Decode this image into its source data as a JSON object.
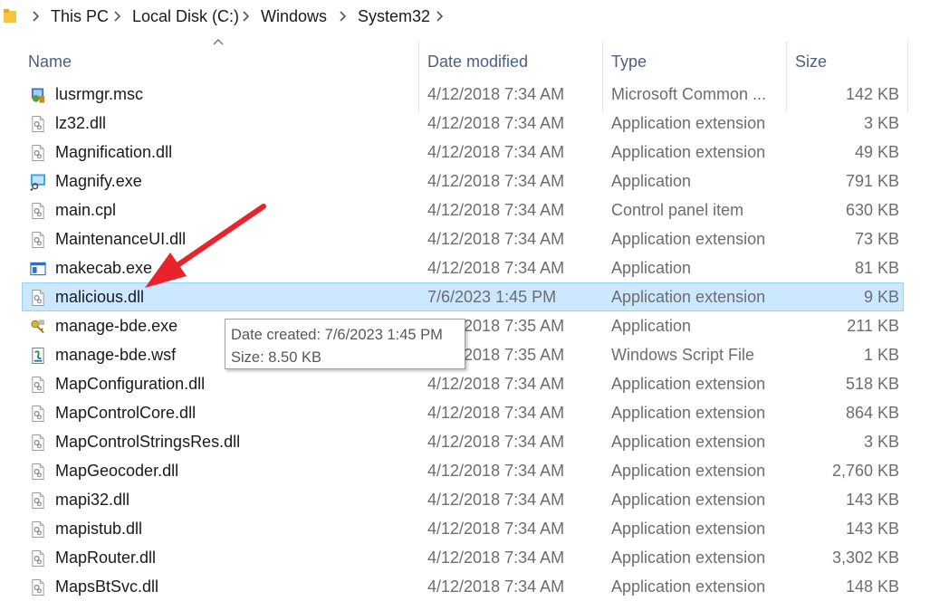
{
  "breadcrumb": {
    "items": [
      "This PC",
      "Local Disk (C:)",
      "Windows",
      "System32"
    ]
  },
  "columns": {
    "name": "Name",
    "date": "Date modified",
    "type": "Type",
    "size": "Size"
  },
  "files": [
    {
      "name": "lusrmgr.msc",
      "date": "4/12/2018 7:34 AM",
      "type": "Microsoft Common ...",
      "size": "142 KB",
      "icon": "msc-icon"
    },
    {
      "name": "lz32.dll",
      "date": "4/12/2018 7:34 AM",
      "type": "Application extension",
      "size": "3 KB",
      "icon": "dll-icon"
    },
    {
      "name": "Magnification.dll",
      "date": "4/12/2018 7:34 AM",
      "type": "Application extension",
      "size": "49 KB",
      "icon": "dll-icon"
    },
    {
      "name": "Magnify.exe",
      "date": "4/12/2018 7:34 AM",
      "type": "Application",
      "size": "791 KB",
      "icon": "magnifier-icon"
    },
    {
      "name": "main.cpl",
      "date": "4/12/2018 7:34 AM",
      "type": "Control panel item",
      "size": "630 KB",
      "icon": "cpl-icon"
    },
    {
      "name": "MaintenanceUI.dll",
      "date": "4/12/2018 7:34 AM",
      "type": "Application extension",
      "size": "73 KB",
      "icon": "dll-icon"
    },
    {
      "name": "makecab.exe",
      "date": "4/12/2018 7:34 AM",
      "type": "Application",
      "size": "81 KB",
      "icon": "exe-window-icon"
    },
    {
      "name": "malicious.dll",
      "date": "7/6/2023 1:45 PM",
      "type": "Application extension",
      "size": "9 KB",
      "icon": "dll-icon",
      "selected": true
    },
    {
      "name": "manage-bde.exe",
      "date": "4/12/2018 7:35 AM",
      "type": "Application",
      "size": "211 KB",
      "icon": "key-icon"
    },
    {
      "name": "manage-bde.wsf",
      "date": "4/12/2018 7:35 AM",
      "type": "Windows Script File",
      "size": "1 KB",
      "icon": "script-icon"
    },
    {
      "name": "MapConfiguration.dll",
      "date": "4/12/2018 7:34 AM",
      "type": "Application extension",
      "size": "518 KB",
      "icon": "dll-icon"
    },
    {
      "name": "MapControlCore.dll",
      "date": "4/12/2018 7:34 AM",
      "type": "Application extension",
      "size": "864 KB",
      "icon": "dll-icon"
    },
    {
      "name": "MapControlStringsRes.dll",
      "date": "4/12/2018 7:34 AM",
      "type": "Application extension",
      "size": "3 KB",
      "icon": "dll-icon"
    },
    {
      "name": "MapGeocoder.dll",
      "date": "4/12/2018 7:34 AM",
      "type": "Application extension",
      "size": "2,760 KB",
      "icon": "dll-icon"
    },
    {
      "name": "mapi32.dll",
      "date": "4/12/2018 7:34 AM",
      "type": "Application extension",
      "size": "143 KB",
      "icon": "dll-icon"
    },
    {
      "name": "mapistub.dll",
      "date": "4/12/2018 7:34 AM",
      "type": "Application extension",
      "size": "143 KB",
      "icon": "dll-icon"
    },
    {
      "name": "MapRouter.dll",
      "date": "4/12/2018 7:34 AM",
      "type": "Application extension",
      "size": "3,302 KB",
      "icon": "dll-icon"
    },
    {
      "name": "MapsBtSvc.dll",
      "date": "4/12/2018 7:34 AM",
      "type": "Application extension",
      "size": "148 KB",
      "icon": "dll-icon"
    }
  ],
  "tooltip": {
    "created": "Date created: 7/6/2023 1:45 PM",
    "size": "Size: 8.50 KB"
  },
  "colors": {
    "selection_bg": "#cce8ff",
    "selection_border": "#99d1ff",
    "header_text": "#4d6082",
    "annotation_arrow": "#e8232b"
  }
}
